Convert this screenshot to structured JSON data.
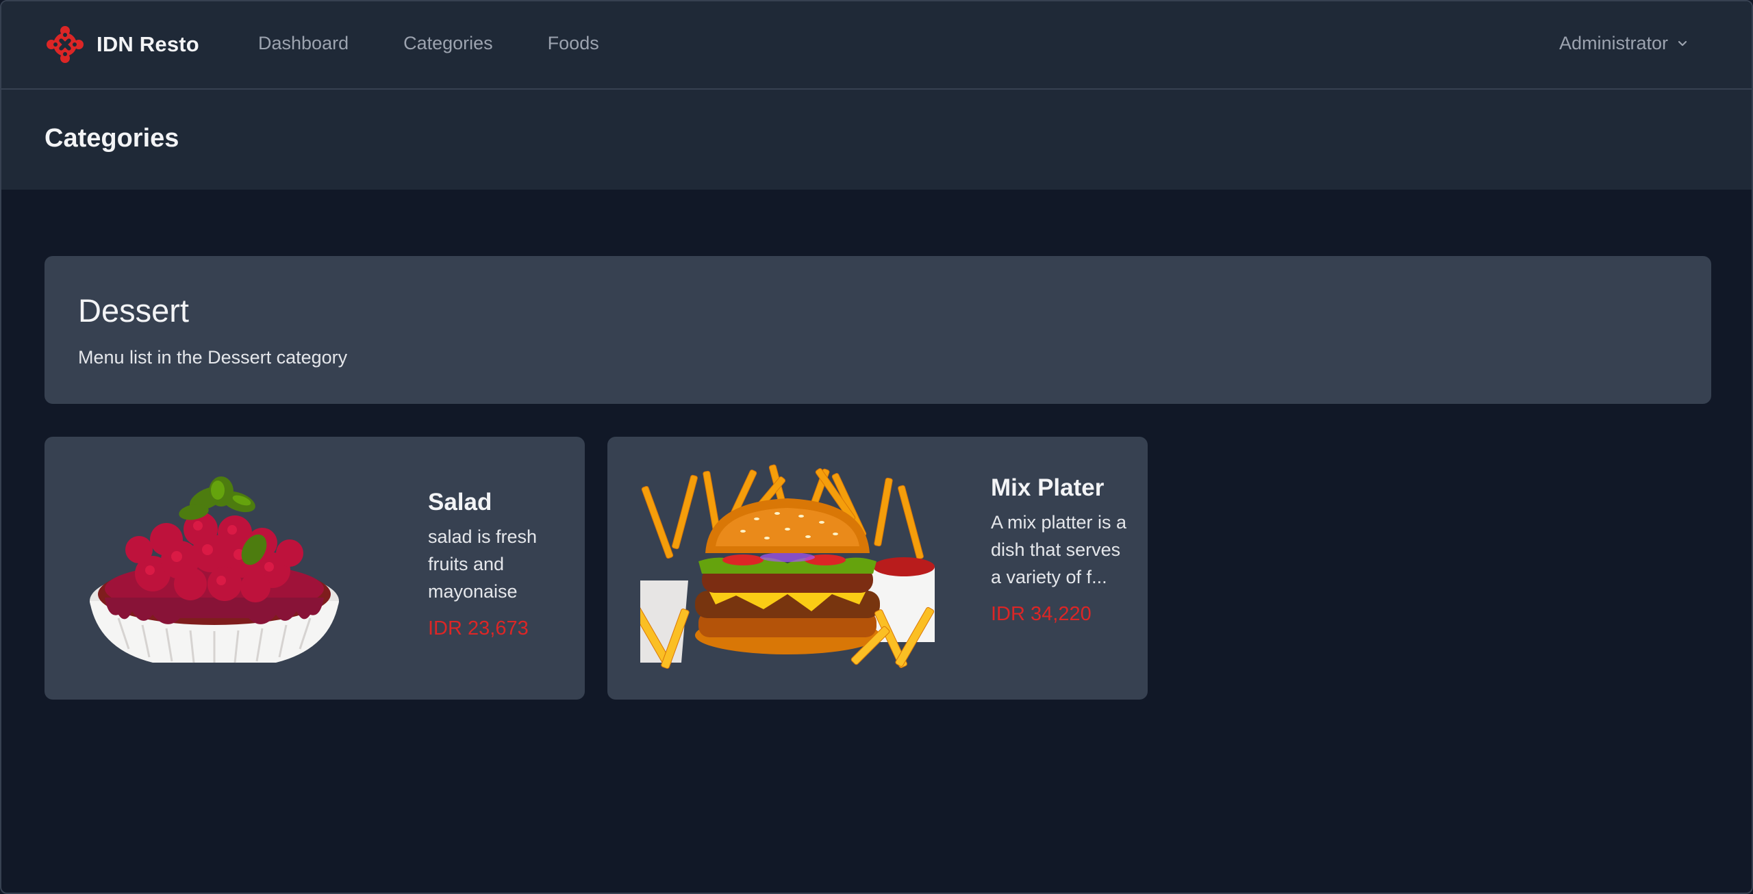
{
  "app": {
    "name": "IDN Resto",
    "brand_color": "#dc2626"
  },
  "nav": {
    "links": [
      {
        "label": "Dashboard"
      },
      {
        "label": "Categories"
      },
      {
        "label": "Foods"
      }
    ],
    "user": "Administrator"
  },
  "page": {
    "title": "Categories"
  },
  "category": {
    "name": "Dessert",
    "description": "Menu list in the Dessert category"
  },
  "foods": [
    {
      "name": "Salad",
      "description": "salad is fresh fruits and mayonaise",
      "price": "IDR 23,673",
      "image": "raspberry-tart-image"
    },
    {
      "name": "Mix Plater",
      "description": "A mix platter is a dish that serves a variety of f...",
      "price": "IDR 34,220",
      "image": "burger-fries-image"
    }
  ]
}
